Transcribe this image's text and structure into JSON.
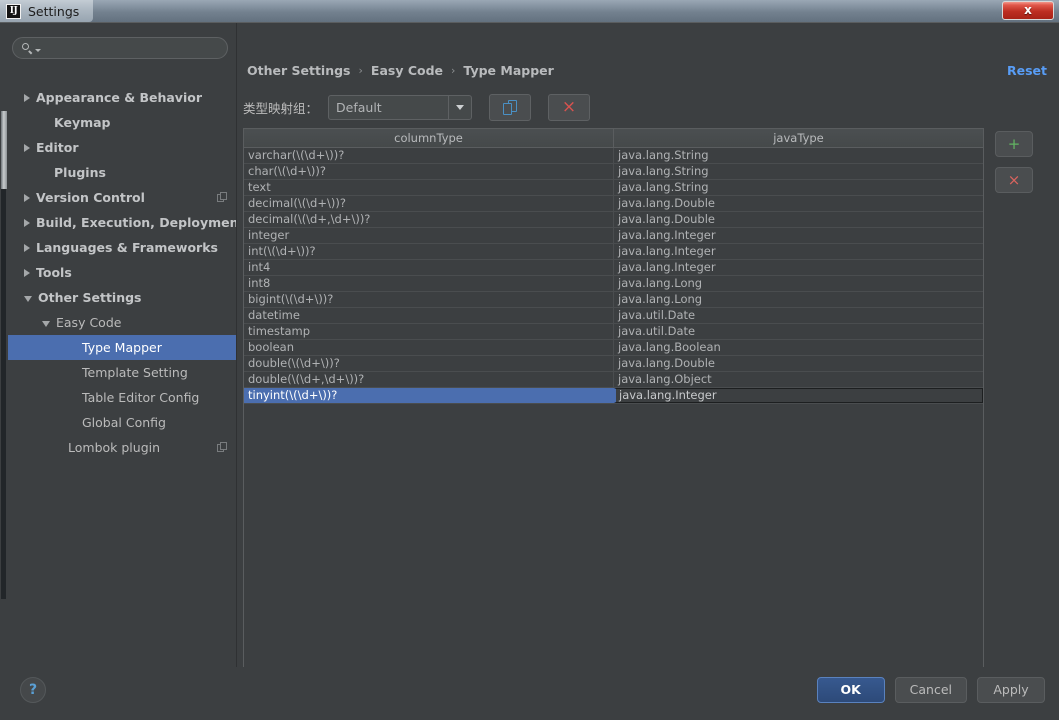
{
  "window": {
    "title": "Settings",
    "logo_text": "IJ",
    "close_label": "x"
  },
  "sidebar": {
    "search": {
      "value": "",
      "placeholder": ""
    },
    "items": [
      {
        "label": "Appearance & Behavior",
        "arrow": "collapsed",
        "indent": 16,
        "bold": true,
        "selected": false,
        "badge": false
      },
      {
        "label": "Keymap",
        "arrow": "none",
        "indent": 34,
        "bold": true,
        "selected": false,
        "badge": false
      },
      {
        "label": "Editor",
        "arrow": "collapsed",
        "indent": 16,
        "bold": true,
        "selected": false,
        "badge": false
      },
      {
        "label": "Plugins",
        "arrow": "none",
        "indent": 34,
        "bold": true,
        "selected": false,
        "badge": false
      },
      {
        "label": "Version Control",
        "arrow": "collapsed",
        "indent": 16,
        "bold": true,
        "selected": false,
        "badge": true
      },
      {
        "label": "Build, Execution, Deployment",
        "arrow": "collapsed",
        "indent": 16,
        "bold": true,
        "selected": false,
        "badge": false
      },
      {
        "label": "Languages & Frameworks",
        "arrow": "collapsed",
        "indent": 16,
        "bold": true,
        "selected": false,
        "badge": false
      },
      {
        "label": "Tools",
        "arrow": "collapsed",
        "indent": 16,
        "bold": true,
        "selected": false,
        "badge": false
      },
      {
        "label": "Other Settings",
        "arrow": "expanded",
        "indent": 16,
        "bold": true,
        "selected": false,
        "badge": false
      },
      {
        "label": "Easy Code",
        "arrow": "expanded",
        "indent": 34,
        "bold": false,
        "selected": false,
        "badge": false
      },
      {
        "label": "Type Mapper",
        "arrow": "none",
        "indent": 62,
        "bold": false,
        "selected": true,
        "badge": false
      },
      {
        "label": "Template Setting",
        "arrow": "none",
        "indent": 62,
        "bold": false,
        "selected": false,
        "badge": false
      },
      {
        "label": "Table Editor Config",
        "arrow": "none",
        "indent": 62,
        "bold": false,
        "selected": false,
        "badge": false
      },
      {
        "label": "Global Config",
        "arrow": "none",
        "indent": 62,
        "bold": false,
        "selected": false,
        "badge": false
      },
      {
        "label": "Lombok plugin",
        "arrow": "none",
        "indent": 48,
        "bold": false,
        "selected": false,
        "badge": true
      }
    ]
  },
  "content": {
    "breadcrumb": [
      "Other Settings",
      "Easy Code",
      "Type Mapper"
    ],
    "breadcrumb_separator": "›",
    "reset_label": "Reset",
    "toolbar": {
      "group_label": "类型映射组：",
      "group_value": "Default",
      "copy_button_name": "copy-icon",
      "delete_button_label": "×"
    },
    "table": {
      "headers": [
        "columnType",
        "javaType"
      ],
      "rows": [
        {
          "columnType": "varchar(\\(\\d+\\))?",
          "javaType": "java.lang.String",
          "selected": false
        },
        {
          "columnType": "char(\\(\\d+\\))?",
          "javaType": "java.lang.String",
          "selected": false
        },
        {
          "columnType": "text",
          "javaType": "java.lang.String",
          "selected": false
        },
        {
          "columnType": "decimal(\\(\\d+\\))?",
          "javaType": "java.lang.Double",
          "selected": false
        },
        {
          "columnType": "decimal(\\(\\d+,\\d+\\))?",
          "javaType": "java.lang.Double",
          "selected": false
        },
        {
          "columnType": "integer",
          "javaType": "java.lang.Integer",
          "selected": false
        },
        {
          "columnType": "int(\\(\\d+\\))?",
          "javaType": "java.lang.Integer",
          "selected": false
        },
        {
          "columnType": "int4",
          "javaType": "java.lang.Integer",
          "selected": false
        },
        {
          "columnType": "int8",
          "javaType": "java.lang.Long",
          "selected": false
        },
        {
          "columnType": "bigint(\\(\\d+\\))?",
          "javaType": "java.lang.Long",
          "selected": false
        },
        {
          "columnType": "datetime",
          "javaType": "java.util.Date",
          "selected": false
        },
        {
          "columnType": "timestamp",
          "javaType": "java.util.Date",
          "selected": false
        },
        {
          "columnType": "boolean",
          "javaType": "java.lang.Boolean",
          "selected": false
        },
        {
          "columnType": "double(\\(\\d+\\))?",
          "javaType": "java.lang.Double",
          "selected": false
        },
        {
          "columnType": "double(\\(\\d+,\\d+\\))?",
          "javaType": "java.lang.Object",
          "selected": false
        },
        {
          "columnType": "tinyint(\\(\\d+\\))?",
          "javaType": "java.lang.Integer",
          "selected": true
        }
      ]
    },
    "side_actions": {
      "add_label": "+",
      "remove_label": "×"
    }
  },
  "footer": {
    "help_label": "?",
    "buttons": [
      {
        "label": "OK",
        "default": true
      },
      {
        "label": "Cancel",
        "default": false
      },
      {
        "label": "Apply",
        "default": false
      }
    ]
  },
  "colors": {
    "accent_selection": "#4b6eaf",
    "link": "#589df6",
    "panel": "#3c3f41",
    "add_green": "#62b562",
    "remove_red": "#d9645e",
    "close_red": "#bd2e22"
  }
}
